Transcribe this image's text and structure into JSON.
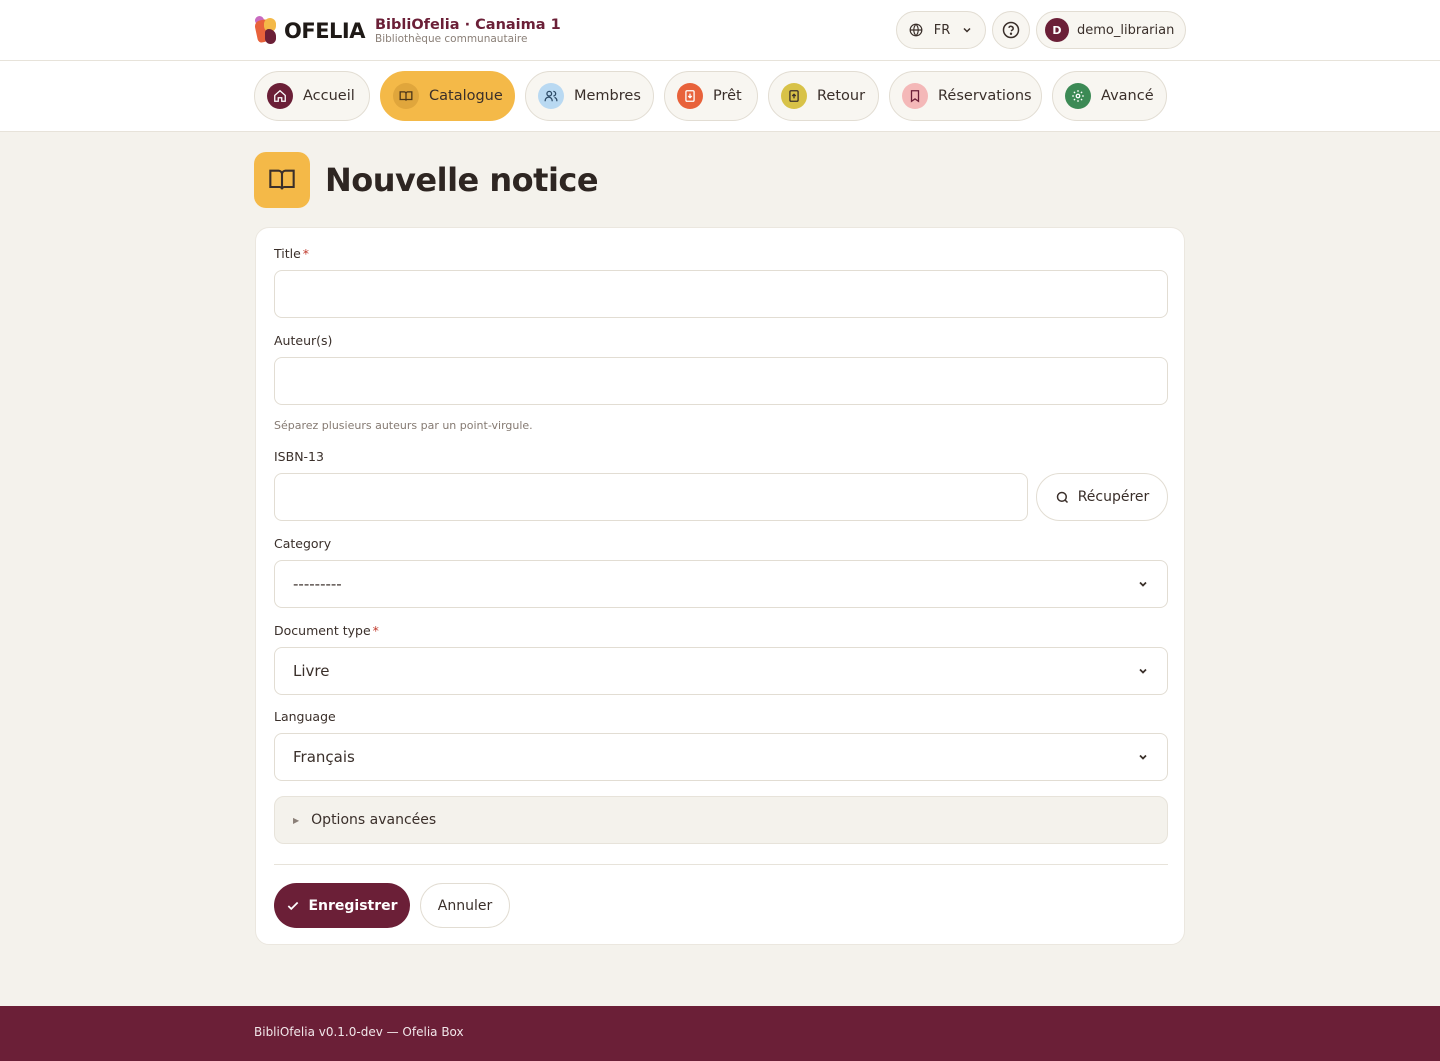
{
  "header": {
    "logo_word": "OFELIA",
    "app_title": "BibliOfelia · Canaima 1",
    "app_subtitle": "Bibliothèque communautaire",
    "language": "FR",
    "user_initial": "D",
    "username": "demo_librarian"
  },
  "nav": {
    "items": [
      {
        "label": "Accueil",
        "icon": "home-icon",
        "icon_bg": "#6b1f37",
        "active": false
      },
      {
        "label": "Catalogue",
        "icon": "book-icon",
        "icon_bg": "#e0a63c",
        "active": true
      },
      {
        "label": "Membres",
        "icon": "users-icon",
        "icon_bg": "#b9d9f2",
        "active": false
      },
      {
        "label": "Prêt",
        "icon": "checkout-icon",
        "icon_bg": "#e8623b",
        "active": false
      },
      {
        "label": "Retour",
        "icon": "return-icon",
        "icon_bg": "#d8c248",
        "active": false
      },
      {
        "label": "Réservations",
        "icon": "bookmark-icon",
        "icon_bg": "#f4b8b8",
        "active": false
      },
      {
        "label": "Avancé",
        "icon": "gear-icon",
        "icon_bg": "#3c8a55",
        "active": false
      }
    ]
  },
  "page": {
    "title": "Nouvelle notice"
  },
  "form": {
    "title_label": "Title",
    "title_value": "",
    "authors_label": "Auteur(s)",
    "authors_value": "",
    "authors_hint": "Séparez plusieurs auteurs par un point-virgule.",
    "isbn_label": "ISBN-13",
    "isbn_value": "",
    "fetch_label": "Récupérer",
    "category_label": "Category",
    "category_value": "---------",
    "doctype_label": "Document type",
    "doctype_value": "Livre",
    "language_label": "Language",
    "language_value": "Français",
    "advanced_label": "Options avancées",
    "required_mark": "*",
    "save_label": "Enregistrer",
    "cancel_label": "Annuler"
  },
  "footer": {
    "text": "BibliOfelia v0.1.0-dev — Ofelia Box"
  },
  "colors": {
    "brand": "#6b1f37",
    "accent": "#f4b948",
    "background": "#f4f2ec"
  }
}
